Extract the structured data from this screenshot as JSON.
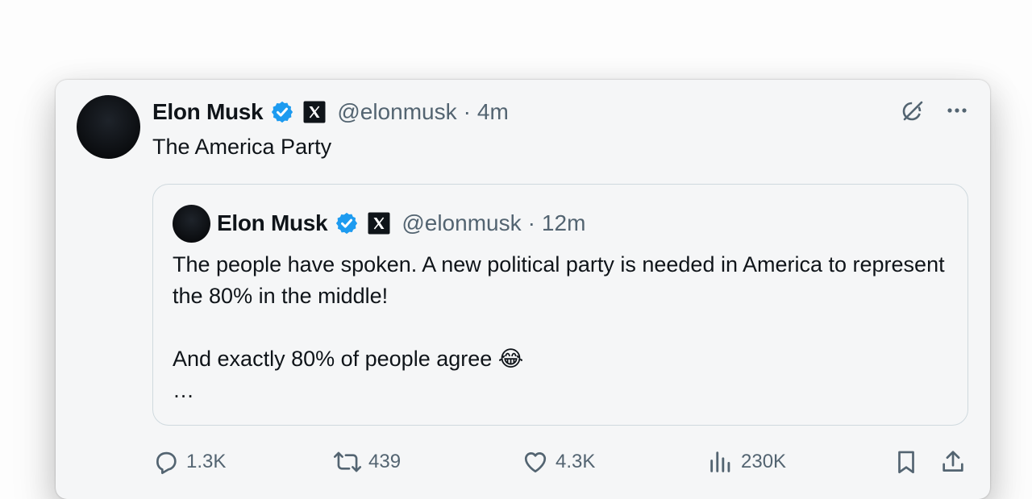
{
  "tweet": {
    "author_name": "Elon Musk",
    "handle": "@elonmusk",
    "separator": "·",
    "time": "4m",
    "text": "The America Party",
    "verified_icon": "verified-badge-icon",
    "affiliation_icon": "x-logo-icon"
  },
  "quoted_tweet": {
    "author_name": "Elon Musk",
    "handle": "@elonmusk",
    "separator": "·",
    "time": "12m",
    "paragraph_1": "The people have spoken. A new political party is needed in America to represent the 80% in the middle!",
    "paragraph_2": "And exactly 80% of people agree 😂",
    "truncation": "…"
  },
  "actions": {
    "replies": "1.3K",
    "reposts": "439",
    "likes": "4.3K",
    "views": "230K"
  },
  "colors": {
    "verified_blue": "#1d9bf0",
    "secondary_text": "#536471",
    "card_background": "#f5f6f7",
    "border": "#cfd9de"
  }
}
